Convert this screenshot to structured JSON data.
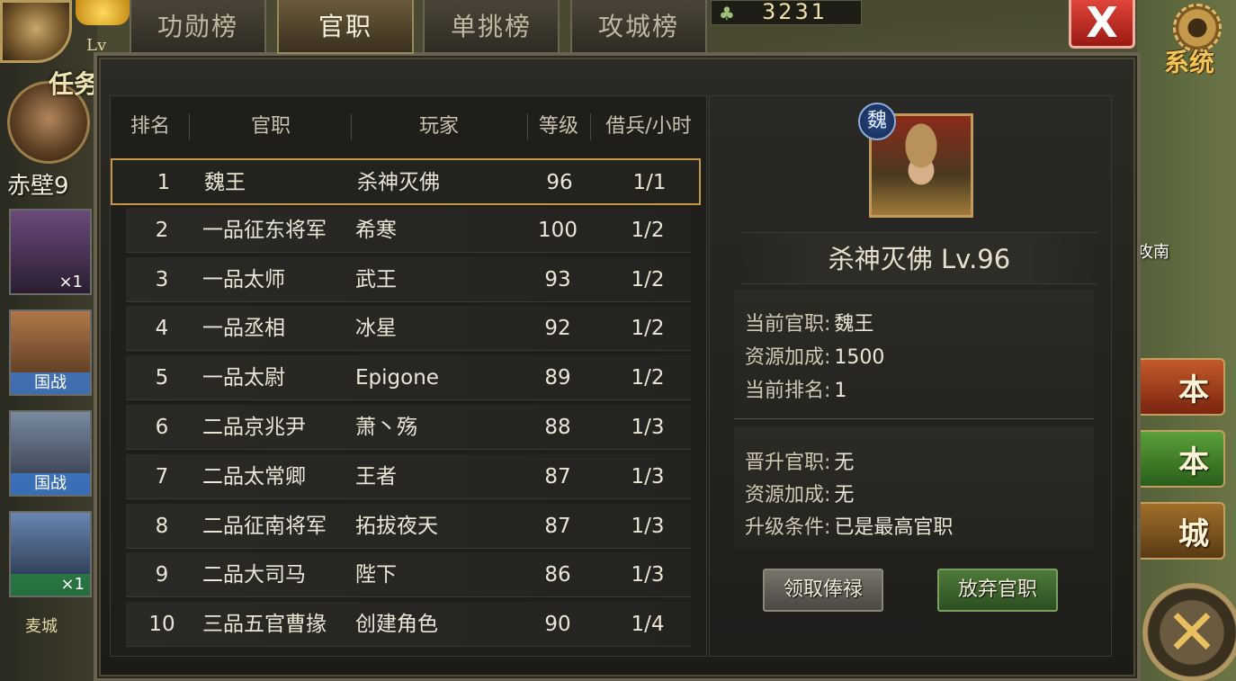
{
  "hud": {
    "level_prefix": "Lv",
    "resource_value": "3231",
    "quest_label": "任务",
    "city_name": "赤壁9",
    "system_label": "系统",
    "close_label": "X",
    "bottom_city": "麦城",
    "map_label": "攻南",
    "side_buttons": [
      "本",
      "本",
      "城"
    ],
    "hero_tags": [
      "×1",
      "国战",
      "国战",
      "×1"
    ]
  },
  "tabs": [
    {
      "label": "功勋榜",
      "active": false
    },
    {
      "label": "官职",
      "active": true
    },
    {
      "label": "单挑榜",
      "active": false
    },
    {
      "label": "攻城榜",
      "active": false
    }
  ],
  "table": {
    "headers": {
      "rank": "排名",
      "title": "官职",
      "player": "玩家",
      "level": "等级",
      "troops": "借兵/小时"
    },
    "rows": [
      {
        "rank": "1",
        "title": "魏王",
        "player": "杀神灭佛",
        "level": "96",
        "troops": "1/1"
      },
      {
        "rank": "2",
        "title": "一品征东将军",
        "player": "希寒",
        "level": "100",
        "troops": "1/2"
      },
      {
        "rank": "3",
        "title": "一品太师",
        "player": "武王",
        "level": "93",
        "troops": "1/2"
      },
      {
        "rank": "4",
        "title": "一品丞相",
        "player": "冰星",
        "level": "92",
        "troops": "1/2"
      },
      {
        "rank": "5",
        "title": "一品太尉",
        "player": "Epigone",
        "level": "89",
        "troops": "1/2"
      },
      {
        "rank": "6",
        "title": "二品京兆尹",
        "player": "萧丶殇",
        "level": "88",
        "troops": "1/3"
      },
      {
        "rank": "7",
        "title": "二品太常卿",
        "player": "王者",
        "level": "87",
        "troops": "1/3"
      },
      {
        "rank": "8",
        "title": "二品征南将军",
        "player": "拓拔夜天",
        "level": "87",
        "troops": "1/3"
      },
      {
        "rank": "9",
        "title": "二品大司马",
        "player": "陛下",
        "level": "86",
        "troops": "1/3"
      },
      {
        "rank": "10",
        "title": "三品五官曹掾",
        "player": "创建角色",
        "level": "90",
        "troops": "1/4"
      }
    ]
  },
  "detail": {
    "faction": "魏",
    "name_line": "杀神灭佛  Lv.96",
    "current_title_label": "当前官职:",
    "current_title_value": "魏王",
    "resource_bonus_label": "资源加成:",
    "resource_bonus_value": "1500",
    "current_rank_label": "当前排名:",
    "current_rank_value": "1",
    "promote_label": "晋升官职:",
    "promote_value": "无",
    "next_bonus_label": "资源加成:",
    "next_bonus_value": "无",
    "upgrade_cond_label": "升级条件:",
    "upgrade_cond_value": "已是最高官职",
    "collect_button": "领取俸禄",
    "abandon_button": "放弃官职"
  }
}
